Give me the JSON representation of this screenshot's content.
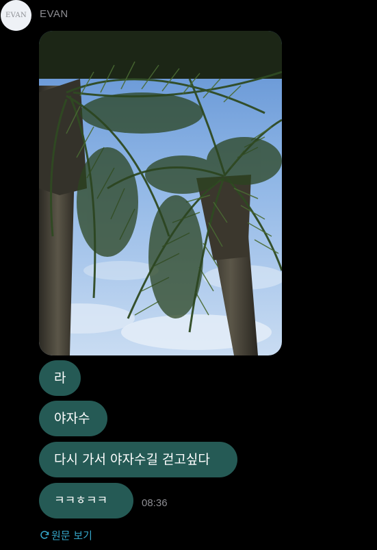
{
  "sender": {
    "avatar_text": "EVAN",
    "name": "EVAN"
  },
  "photo": {
    "description_icon": "palm-trees-photo"
  },
  "messages": [
    {
      "text": "라"
    },
    {
      "text": "야자수"
    },
    {
      "text": "다시 가서 야자수길 걷고싶다"
    },
    {
      "text": "ㅋㅋㅎㅋㅋ"
    }
  ],
  "last_time": "08:36",
  "translate_link": {
    "icon": "refresh-icon",
    "label": "원문 보기"
  },
  "colors": {
    "background": "#000000",
    "bubble": "#255a55",
    "meta_text": "#8e8e93",
    "link": "#35a6c9"
  }
}
